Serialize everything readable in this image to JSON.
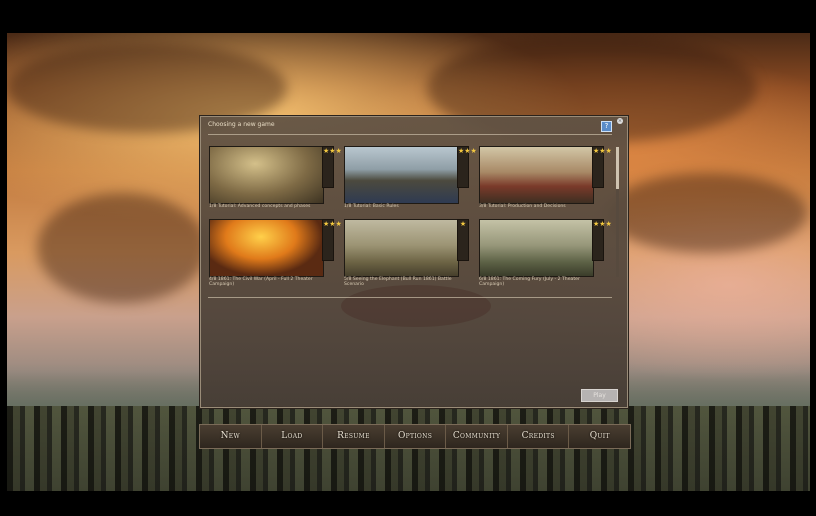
{
  "dialog": {
    "title": "Choosing a new game",
    "play_label": "Play",
    "scenarios": [
      {
        "caption": "1/8 Tutorial: Advanced concepts and phases",
        "stars": "★★★"
      },
      {
        "caption": "1/8 Tutorial: Basic Rules",
        "stars": "★★★"
      },
      {
        "caption": "3/8 Tutorial: Production and Decisions",
        "stars": "★★★"
      },
      {
        "caption": "4/8 1861: The Civil War (April - Full 2 Theater Campaign)",
        "stars": "★★★"
      },
      {
        "caption": "5/8 Seeing the Elephant (Bull Run 1861) Battle Scenario",
        "stars": "★"
      },
      {
        "caption": "6/8 1861: The Coming Fury (July - 2 Theater Campaign)",
        "stars": "★★★"
      }
    ]
  },
  "menu": {
    "items": [
      "New",
      "Load",
      "Resume",
      "Options",
      "Community",
      "Credits",
      "Quit"
    ]
  }
}
